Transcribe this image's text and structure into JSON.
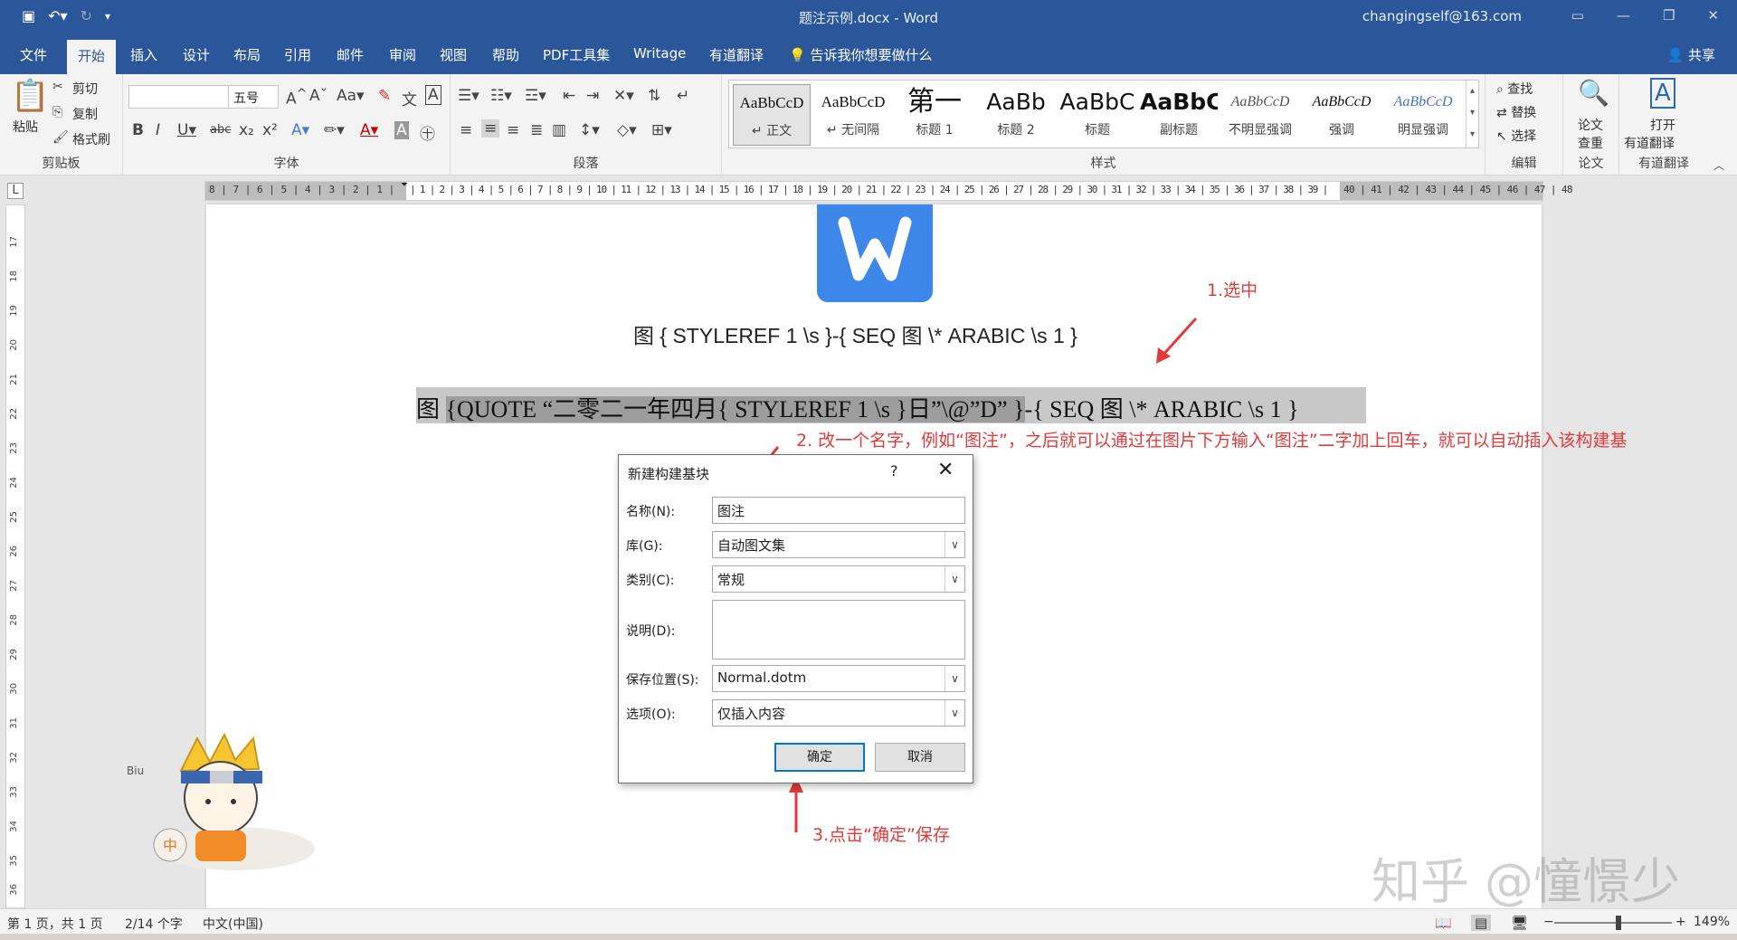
{
  "window": {
    "title": "题注示例.docx  -  Word",
    "account": "changingself@163.com"
  },
  "tabs": [
    "文件",
    "开始",
    "插入",
    "设计",
    "布局",
    "引用",
    "邮件",
    "审阅",
    "视图",
    "帮助",
    "PDF工具集",
    "Writage",
    "有道翻译"
  ],
  "active_tab": "开始",
  "tell_me": "告诉我你想要做什么",
  "share": "共享",
  "ribbon": {
    "clipboard": {
      "paste": "粘贴",
      "cut": "剪切",
      "copy": "复制",
      "format_painter": "格式刷",
      "label": "剪贴板"
    },
    "font": {
      "font_name": "",
      "font_size": "五号",
      "label": "字体"
    },
    "paragraph": {
      "label": "段落"
    },
    "styles": {
      "label": "样式",
      "items": [
        {
          "preview": "AaBbCcD",
          "name": "↵ 正文"
        },
        {
          "preview": "AaBbCcD",
          "name": "↵ 无间隔"
        },
        {
          "preview": "第一",
          "name": "标题 1"
        },
        {
          "preview": "AaBb",
          "name": "标题 2"
        },
        {
          "preview": "AaBbC",
          "name": "标题"
        },
        {
          "preview": "AaBbC",
          "name": "副标题"
        },
        {
          "preview": "AaBbCcD",
          "name": "不明显强调"
        },
        {
          "preview": "AaBbCcD",
          "name": "强调"
        },
        {
          "preview": "AaBbCcD",
          "name": "明显强调"
        }
      ]
    },
    "editing": {
      "find": "查找",
      "replace": "替换",
      "select": "选择",
      "label": "编辑"
    },
    "paper": {
      "btn1": "论文",
      "btn2": "查重",
      "label": "论文"
    },
    "youdao": {
      "btn1": "打开",
      "btn2": "有道翻译",
      "label": "有道翻译"
    }
  },
  "ruler": {
    "left_numbers": "8 | 7 | 6 | 5 | 4 | 3 | 2 | 1 |",
    "right_numbers": "| 1 | 2 | 3 | 4 | 5 | 6 | 7 | 8 | 9 | 10 | 11 | 12 | 13 | 14 | 15 | 16 | 17 | 18 | 19 | 20 | 21 | 22 | 23 | 24 | 25 | 26 | 27 | 28 | 29 | 30 | 31 | 32 | 33 | 34 | 35 | 36 | 37 | 38 | 39 |",
    "tail_numbers": "40 | 41 | 42 | 43 | 44 | 45 | 46 | 47 | 48",
    "vertical": [
      "17",
      "18",
      "19",
      "20",
      "21",
      "22",
      "23",
      "24",
      "25",
      "26",
      "27",
      "28",
      "29",
      "30",
      "31",
      "32",
      "33",
      "34",
      "35",
      "36"
    ]
  },
  "document": {
    "line1": "图 { STYLEREF 1 \\s }-{ SEQ 图 \\* ARABIC \\s 1 }",
    "line2_prefix": "图 ",
    "line2_quote": "{QUOTE “二零二一年四月{ STYLEREF 1 \\s }日”\\@”D” }",
    "line2_suffix": "-{ SEQ 图 \\* ARABIC \\s 1 }"
  },
  "annotations": {
    "step1": "1.选中",
    "step2": "2. 改一个名字，例如“图注”，之后就可以通过在图片下方输入“图注”二字加上回车，就可以自动插入该构建基",
    "step3": "3.点击“确定”保存"
  },
  "dialog": {
    "title": "新建构建基块",
    "help": "?",
    "close": "✕",
    "name_label": "名称(N):",
    "name_value": "图注",
    "gallery_label": "库(G):",
    "gallery_value": "自动图文集",
    "category_label": "类别(C):",
    "category_value": "常规",
    "description_label": "说明(D):",
    "description_value": "",
    "save_label": "保存位置(S):",
    "save_value": "Normal.dotm",
    "options_label": "选项(O):",
    "options_value": "仅插入内容",
    "ok": "确定",
    "cancel": "取消"
  },
  "status": {
    "page": "第 1 页，共 1 页",
    "words": "2/14 个字",
    "language": "中文(中国)",
    "zoom": "149%",
    "zoom_level_percent": 149
  },
  "watermark": "知乎 @憧憬少",
  "colors": {
    "titlebar": "#2b579a",
    "annotation": "#e23a3a",
    "logo": "#3d86ea"
  }
}
